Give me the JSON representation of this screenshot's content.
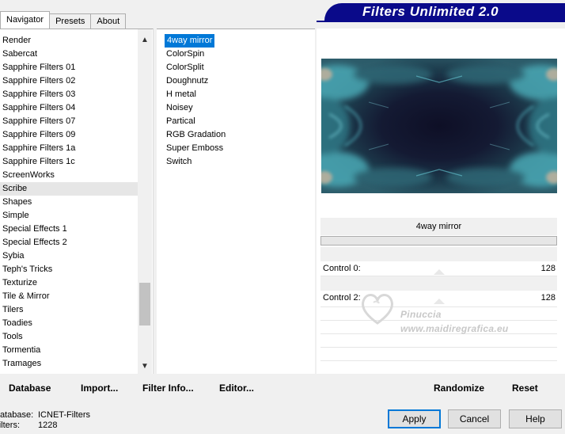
{
  "tabs": [
    {
      "label": "Navigator",
      "active": true
    },
    {
      "label": "Presets",
      "active": false
    },
    {
      "label": "About",
      "active": false
    }
  ],
  "banner": {
    "title": "Filters Unlimited 2.0",
    "color": "#0a0a8a"
  },
  "categories": {
    "items": [
      "Render",
      "Sabercat",
      "Sapphire Filters 01",
      "Sapphire Filters 02",
      "Sapphire Filters 03",
      "Sapphire Filters 04",
      "Sapphire Filters 07",
      "Sapphire Filters 09",
      "Sapphire Filters 1a",
      "Sapphire Filters 1c",
      "ScreenWorks",
      "Scribe",
      "Shapes",
      "Simple",
      "Special Effects 1",
      "Special Effects 2",
      "Sybia",
      "Teph's Tricks",
      "Texturize",
      "Tile & Mirror",
      "Tilers",
      "Toadies",
      "Tools",
      "Tormentia",
      "Tramages"
    ],
    "selected": "Scribe"
  },
  "filters": {
    "items": [
      "4way mirror",
      "ColorSpin",
      "ColorSplit",
      "Doughnutz",
      "H metal",
      "Noisey",
      "Partical",
      "RGB Gradation",
      "Super Emboss",
      "Switch"
    ],
    "selected": "4way mirror",
    "selected_color": "#0078d7"
  },
  "filter_name": "4way mirror",
  "controls": [
    {
      "label": "Control 0:",
      "value": "128"
    },
    {
      "label": "Control 2:",
      "value": "128"
    }
  ],
  "watermark": {
    "name": "Pinuccia",
    "site": "www.maidiregrafica.eu"
  },
  "bottom_buttons": {
    "database": "Database",
    "import": "Import...",
    "filter_info": "Filter Info...",
    "editor": "Editor...",
    "randomize": "Randomize",
    "reset": "Reset"
  },
  "status": {
    "database_label": "Database:",
    "database_value": "ICNET-Filters",
    "filters_label": "Filters:",
    "filters_value": "1228"
  },
  "dialog_buttons": {
    "apply": "Apply",
    "cancel": "Cancel",
    "help": "Help"
  },
  "icons": {
    "scroll_up": "chevron-up-icon",
    "scroll_down": "chevron-down-icon",
    "watermark": "heart-icon"
  }
}
